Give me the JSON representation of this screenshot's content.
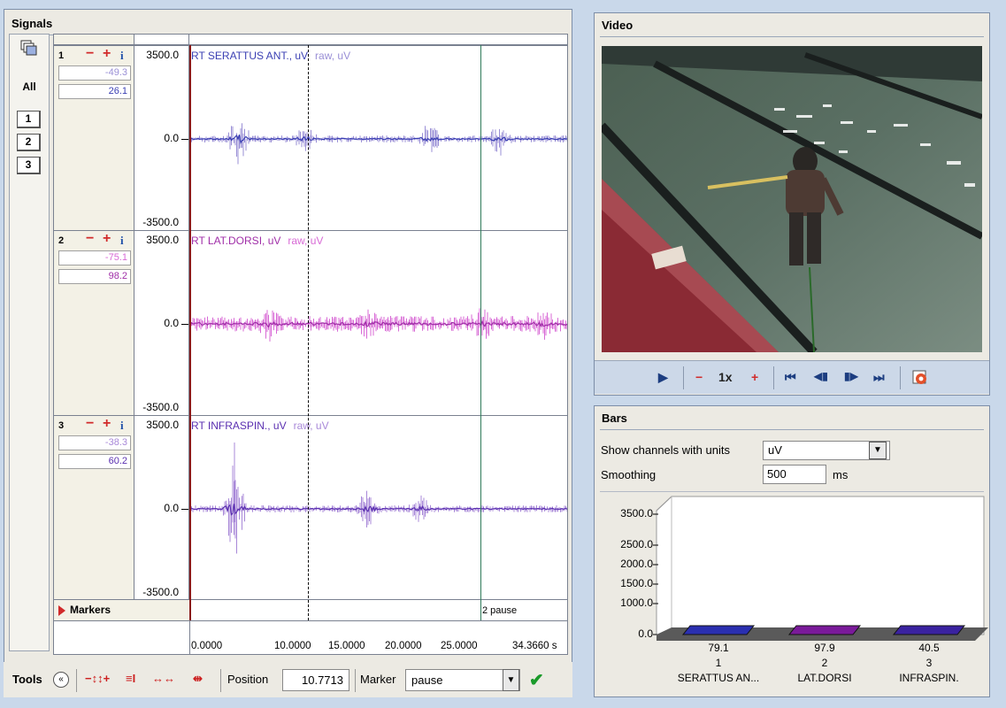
{
  "signals": {
    "title": "Signals",
    "all_label": "All",
    "channel_buttons": [
      "1",
      "2",
      "3"
    ],
    "channels": [
      {
        "num": "1",
        "minus": "−",
        "plus": "+",
        "info": "i",
        "min_value": "-49.3",
        "max_value": "26.1",
        "scale_top": "3500.0",
        "scale_mid": "0.0",
        "scale_bottom": "-3500.0",
        "name": "RT SERATTUS ANT., uV",
        "raw": "raw, uV",
        "color": "#3a3fb3",
        "raw_color": "#9a8fd6"
      },
      {
        "num": "2",
        "minus": "−",
        "plus": "+",
        "info": "i",
        "min_value": "-75.1",
        "max_value": "98.2",
        "scale_top": "3500.0",
        "scale_mid": "0.0",
        "scale_bottom": "-3500.0",
        "name": "RT LAT.DORSI, uV",
        "raw": "raw, uV",
        "color": "#a02ea8",
        "raw_color": "#d86ad6"
      },
      {
        "num": "3",
        "minus": "−",
        "plus": "+",
        "info": "i",
        "min_value": "-38.3",
        "max_value": "60.2",
        "scale_top": "3500.0",
        "scale_mid": "0.0",
        "scale_bottom": "-3500.0",
        "name": "RT INFRASPIN., uV",
        "raw": "raw, uV",
        "color": "#5a2fb0",
        "raw_color": "#a888d8"
      }
    ],
    "markers_label": "Markers",
    "marker_text": "2 pause",
    "time_labels": [
      "0.0000",
      "10.0000",
      "15.0000",
      "20.0000",
      "25.0000",
      "34.3660 s"
    ]
  },
  "tools": {
    "label": "Tools",
    "collapse_icon": "«",
    "position_label": "Position",
    "position_value": "10.7713",
    "marker_label": "Marker",
    "marker_value": "pause",
    "confirm": "✔"
  },
  "video": {
    "title": "Video",
    "play": "▶",
    "minus": "−",
    "speed": "1x",
    "plus": "+",
    "first": "⏮",
    "prev": "◀▮",
    "next": "▮▶",
    "last": "⏭"
  },
  "bars": {
    "title": "Bars",
    "show_label": "Show channels with units",
    "units_value": "uV",
    "smoothing_label": "Smoothing",
    "smoothing_value": "500",
    "smoothing_unit": "ms",
    "y_ticks": [
      "3500.0",
      "2500.0",
      "2000.0",
      "1500.0",
      "1000.0",
      "0.0"
    ]
  },
  "chart_data": {
    "type": "bar",
    "categories": [
      "SERATTUS AN...",
      "LAT.DORSI",
      "INFRASPIN."
    ],
    "channel_numbers": [
      "1",
      "2",
      "3"
    ],
    "values": [
      79.1,
      97.9,
      40.5
    ],
    "value_labels": [
      "79.1",
      "97.9",
      "40.5"
    ],
    "colors": [
      "#2a2fb0",
      "#7a1a9a",
      "#3a22a0"
    ],
    "ylim": [
      0,
      3500
    ]
  }
}
